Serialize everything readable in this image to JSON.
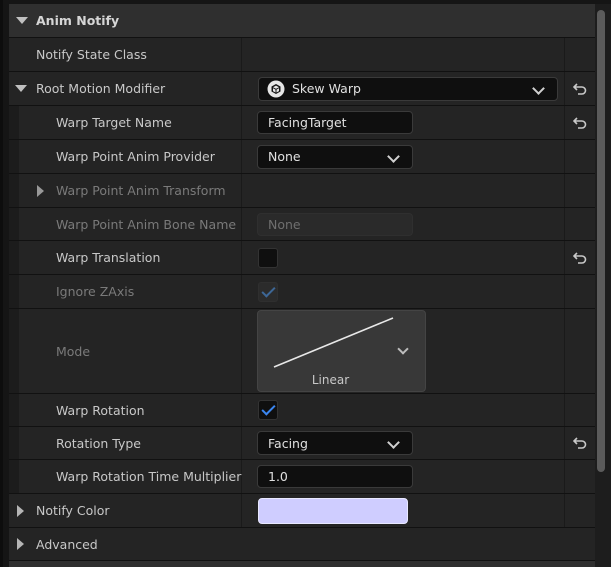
{
  "section": {
    "title": "Anim Notify"
  },
  "rows": {
    "notify_state_class": {
      "label": "Notify State Class"
    },
    "root_motion_modifier": {
      "label": "Root Motion Modifier",
      "value": "Skew Warp"
    },
    "warp_target_name": {
      "label": "Warp Target Name",
      "value": "FacingTarget"
    },
    "warp_point_anim_provider": {
      "label": "Warp Point Anim Provider",
      "value": "None"
    },
    "warp_point_anim_transform": {
      "label": "Warp Point Anim Transform"
    },
    "warp_point_anim_bone_name": {
      "label": "Warp Point Anim Bone Name",
      "placeholder": "None"
    },
    "warp_translation": {
      "label": "Warp Translation",
      "checked": false
    },
    "ignore_zaxis": {
      "label": "Ignore ZAxis",
      "checked": true
    },
    "mode": {
      "label": "Mode",
      "value": "Linear"
    },
    "warp_rotation": {
      "label": "Warp Rotation",
      "checked": true
    },
    "rotation_type": {
      "label": "Rotation Type",
      "value": "Facing"
    },
    "warp_rotation_time_multiplier": {
      "label": "Warp Rotation Time Multiplier",
      "value": "1.0"
    },
    "notify_color": {
      "label": "Notify Color",
      "color": "#cfcdff"
    },
    "advanced": {
      "label": "Advanced"
    }
  },
  "colors": {
    "accent": "#3b86f0",
    "background": "#242424"
  }
}
